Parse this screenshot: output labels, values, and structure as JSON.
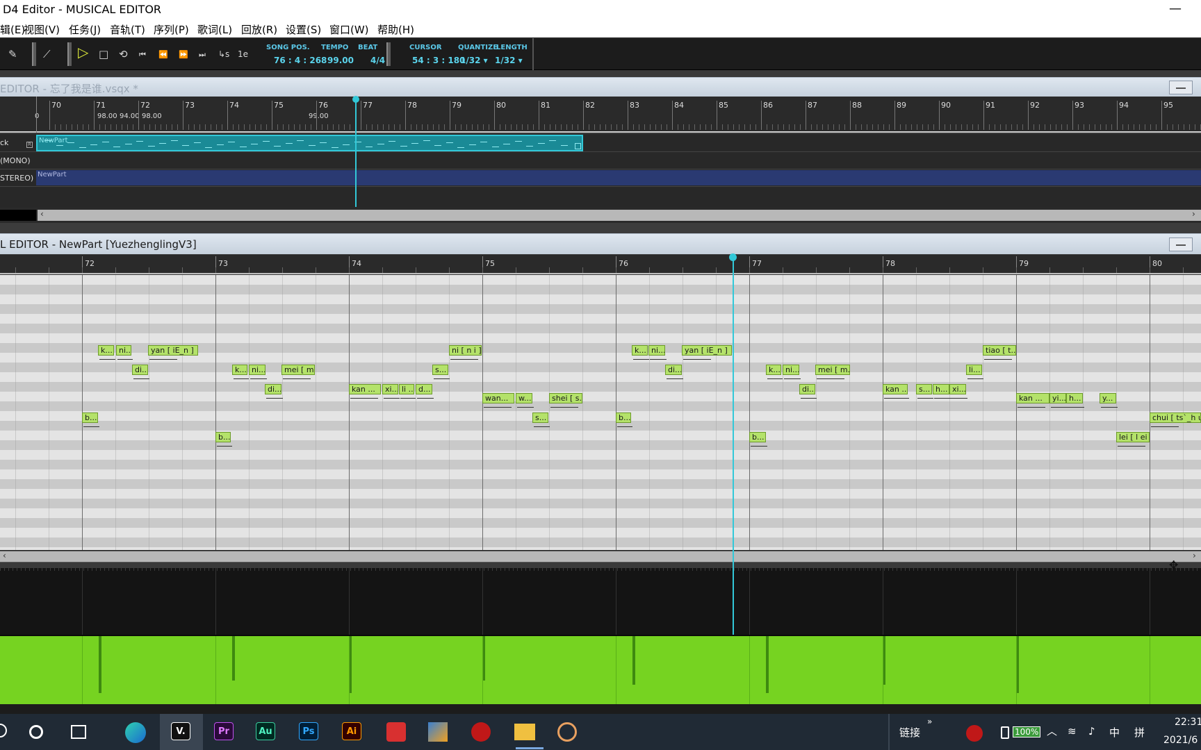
{
  "window": {
    "title": "D4 Editor - MUSICAL EDITOR",
    "minimize_icon": "—"
  },
  "menu": [
    "辑(E)",
    "视图(V)",
    "任务(J)",
    "音轨(T)",
    "序列(P)",
    "歌词(L)",
    "回放(R)",
    "设置(S)",
    "窗口(W)",
    "帮助(H)"
  ],
  "toolbar": {
    "labels": {
      "song_pos": "SONG POS.",
      "tempo": "TEMPO",
      "beat": "BEAT",
      "cursor": "CURSOR",
      "quantize": "QUANTIZE",
      "length": "LENGTH"
    },
    "values": {
      "song_pos": "76 : 4 : 268",
      "tempo": "99.00",
      "beat": "4/4",
      "cursor": "54 : 3 : 180",
      "quantize": "1/32 ▾",
      "length": "1/32 ▾"
    },
    "icons": {
      "pencil": "✎",
      "line": "⟋",
      "play": "▷",
      "stop": "□",
      "loop": "⟲",
      "rewind_start": "⏮",
      "rewind": "⏪",
      "forward": "⏩",
      "forward_end": "⏭",
      "punch_start": "↳s",
      "punch_end": "1e"
    }
  },
  "track_editor": {
    "title": "EDITOR - 忘了我是谁.vsqx *",
    "ruler_left_label": "0",
    "ruler_tempo": [
      "98.00",
      "94.00",
      "98.00",
      "99.00"
    ],
    "bars": [
      "70",
      "71",
      "72",
      "73",
      "74",
      "75",
      "76",
      "77",
      "78",
      "79",
      "80",
      "81",
      "82",
      "83",
      "84",
      "85",
      "86",
      "87",
      "88",
      "89",
      "90",
      "91",
      "92",
      "93",
      "94",
      "95"
    ],
    "tracks": [
      {
        "label": "ck",
        "part": "NewPart",
        "badge": "R"
      },
      {
        "label": "(MONO)"
      },
      {
        "label": "STEREO)",
        "part": "NewPart"
      }
    ],
    "scroll_left": "‹",
    "scroll_right": "›"
  },
  "musical_editor": {
    "title": "L EDITOR - NewPart [YuezhenglingV3]",
    "bars": [
      "72",
      "73",
      "74",
      "75",
      "76",
      "77",
      "78",
      "79",
      "80"
    ],
    "notes": [
      "k...",
      "ni...",
      "yan [ iE_n ]",
      "di...",
      "b...",
      "k...",
      "ni...",
      "mei [ m...",
      "di...",
      "b...",
      "kan ...",
      "xi...",
      "li ...",
      "d...",
      "s...",
      "ni [ n i ]",
      "wan...",
      "w...",
      "shei [ s...",
      "s...",
      "b...",
      "k...",
      "ni...",
      "yan [ iE_n ]",
      "di...",
      "b...",
      "k...",
      "ni...",
      "mei [ m...",
      "di...",
      "kan ...",
      "s...",
      "h...",
      "xi...",
      "li...",
      "tiao [ t...",
      "kan ...",
      "yi...",
      "h...",
      "y...",
      "lei [ l ei ]",
      "chui [ ts`_h uei ]"
    ],
    "scroll_left": "‹",
    "scroll_right": "›"
  },
  "taskbar": {
    "apps": [
      "V.",
      "Pr",
      "Au",
      "Ps",
      "Ai"
    ],
    "tray_link": "链接",
    "tray_chevron": "»",
    "battery": "100%",
    "ime": "中",
    "ime2": "拼",
    "time": "22:31",
    "date": "2021/6"
  },
  "colors": {
    "cyan": "#32c8d8",
    "lyric_green": "#b4e26a",
    "pitch_green": "#76d321",
    "toolbar_text": "#5bd4ec"
  }
}
